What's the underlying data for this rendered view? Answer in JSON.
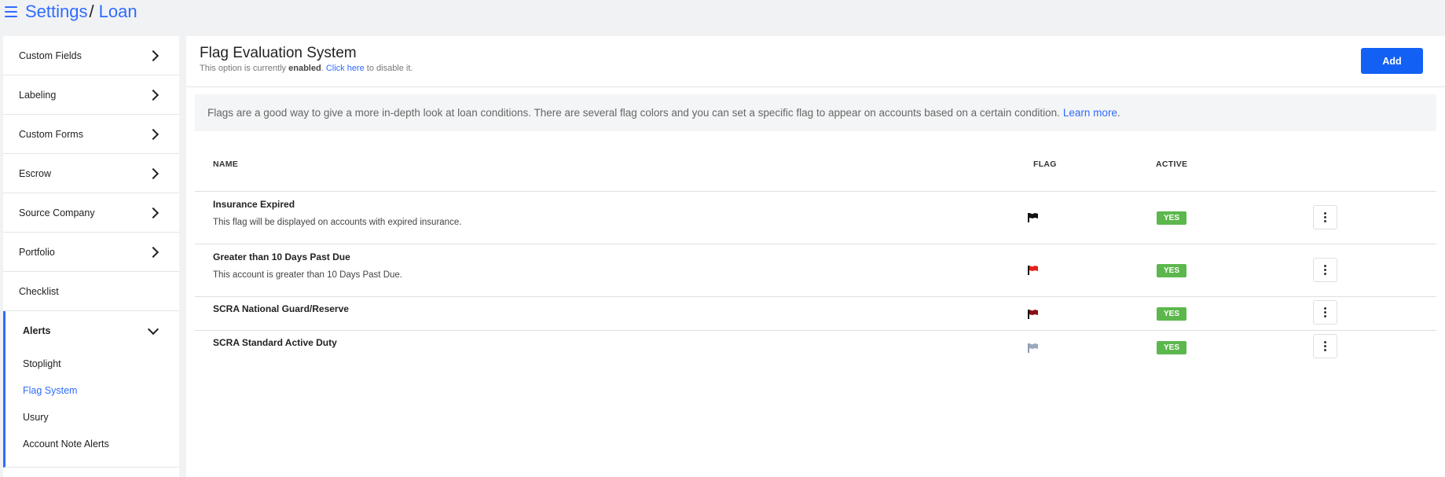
{
  "breadcrumb": {
    "root": "Settings",
    "separator": "/",
    "current": "Loan"
  },
  "sidebar": {
    "items": [
      {
        "label": "Custom Fields",
        "icon": "chevron-right-icon"
      },
      {
        "label": "Labeling",
        "icon": "chevron-right-icon"
      },
      {
        "label": "Custom Forms",
        "icon": "chevron-right-icon"
      },
      {
        "label": "Escrow",
        "icon": "chevron-right-icon"
      },
      {
        "label": "Source Company",
        "icon": "chevron-right-icon"
      },
      {
        "label": "Portfolio",
        "icon": "chevron-right-icon"
      },
      {
        "label": "Checklist"
      }
    ],
    "group": {
      "label": "Alerts",
      "icon": "chevron-down-icon",
      "children": [
        "Stoplight",
        "Flag System",
        "Usury",
        "Account Note Alerts"
      ],
      "active": "Flag System"
    }
  },
  "main": {
    "title": "Flag Evaluation System",
    "status": {
      "prefix": "This option is currently",
      "state": "enabled",
      "link": "Click here",
      "suffix": "to disable it."
    },
    "add_label": "Add",
    "info": {
      "text": "Flags are a good way to give a more in-depth look at loan conditions. There are several flag colors and you can set a specific flag to appear on accounts based on a certain condition.",
      "link": "Learn more",
      "end": "."
    },
    "table": {
      "headers": {
        "name": "NAME",
        "flag": "FLAG",
        "active": "ACTIVE"
      },
      "rows": [
        {
          "name": "Insurance Expired",
          "description": "This flag will be displayed on accounts with expired insurance.",
          "flag_color": "#111111",
          "active": "YES"
        },
        {
          "name": "Greater than 10 Days Past Due",
          "description": "This account is greater than 10 Days Past Due.",
          "flag_color": "#e8201a",
          "active": "YES"
        },
        {
          "name": "SCRA National Guard/Reserve",
          "description": "",
          "flag_color": "#8b0f12",
          "active": "YES"
        },
        {
          "name": "SCRA Standard Active Duty",
          "description": "",
          "flag_color": "#9aa9bd",
          "active": "YES"
        }
      ]
    }
  },
  "colors": {
    "accent": "#2f6bff",
    "button": "#1360f5",
    "badge": "#5cb74d"
  }
}
